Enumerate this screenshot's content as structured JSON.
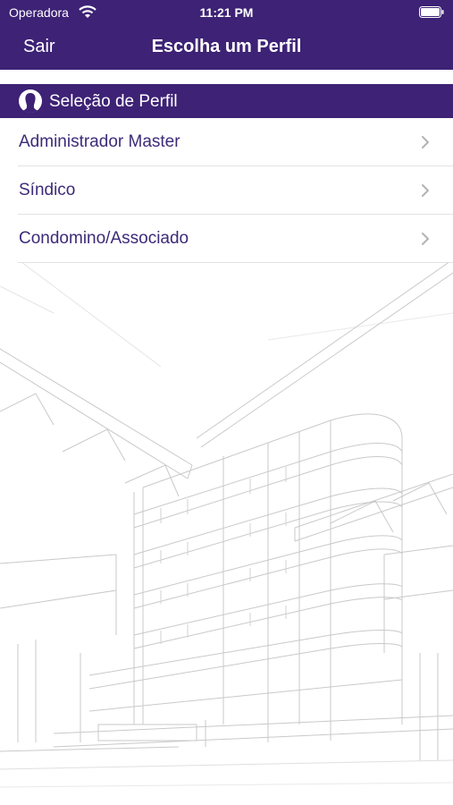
{
  "status_bar": {
    "carrier": "Operadora",
    "time": "11:21 PM"
  },
  "nav": {
    "back_label": "Sair",
    "title": "Escolha um Perfil"
  },
  "section": {
    "title": "Seleção de Perfil"
  },
  "profiles": [
    {
      "label": "Administrador Master"
    },
    {
      "label": "Síndico"
    },
    {
      "label": "Condomino/Associado"
    }
  ],
  "colors": {
    "brand": "#3d2275",
    "item_text": "#3d2b78",
    "chevron": "#b3b3b3"
  },
  "icons": {
    "wifi": "wifi-icon",
    "battery": "battery-icon",
    "profile": "user-silhouette-icon",
    "chevron": "chevron-right-icon"
  }
}
